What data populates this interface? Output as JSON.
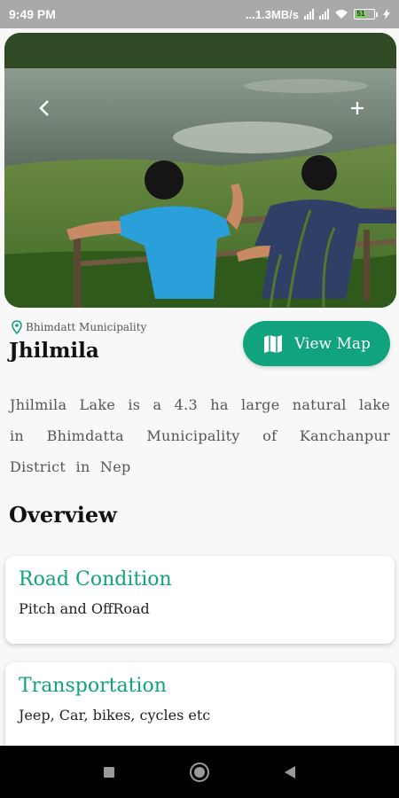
{
  "status": {
    "time": "9:49 PM",
    "network": "...1.3MB/s",
    "battery": "51"
  },
  "hero": {
    "back_icon": "chevron-left-icon",
    "add_icon": "plus-icon"
  },
  "place": {
    "location": "Bhimdatt Municipality",
    "title": "Jhilmila",
    "view_map_label": "View Map",
    "description": "Jhilmila Lake is a 4.3 ha large natural lake in Bhimdatta Municipality of Kanchanpur District in Nep"
  },
  "overview": {
    "heading": "Overview",
    "cards": [
      {
        "title": "Road Condition",
        "text": "Pitch and OffRoad"
      },
      {
        "title": "Transportation",
        "text": "Jeep, Car, bikes, cycles etc"
      }
    ]
  },
  "colors": {
    "accent": "#11a37d"
  }
}
